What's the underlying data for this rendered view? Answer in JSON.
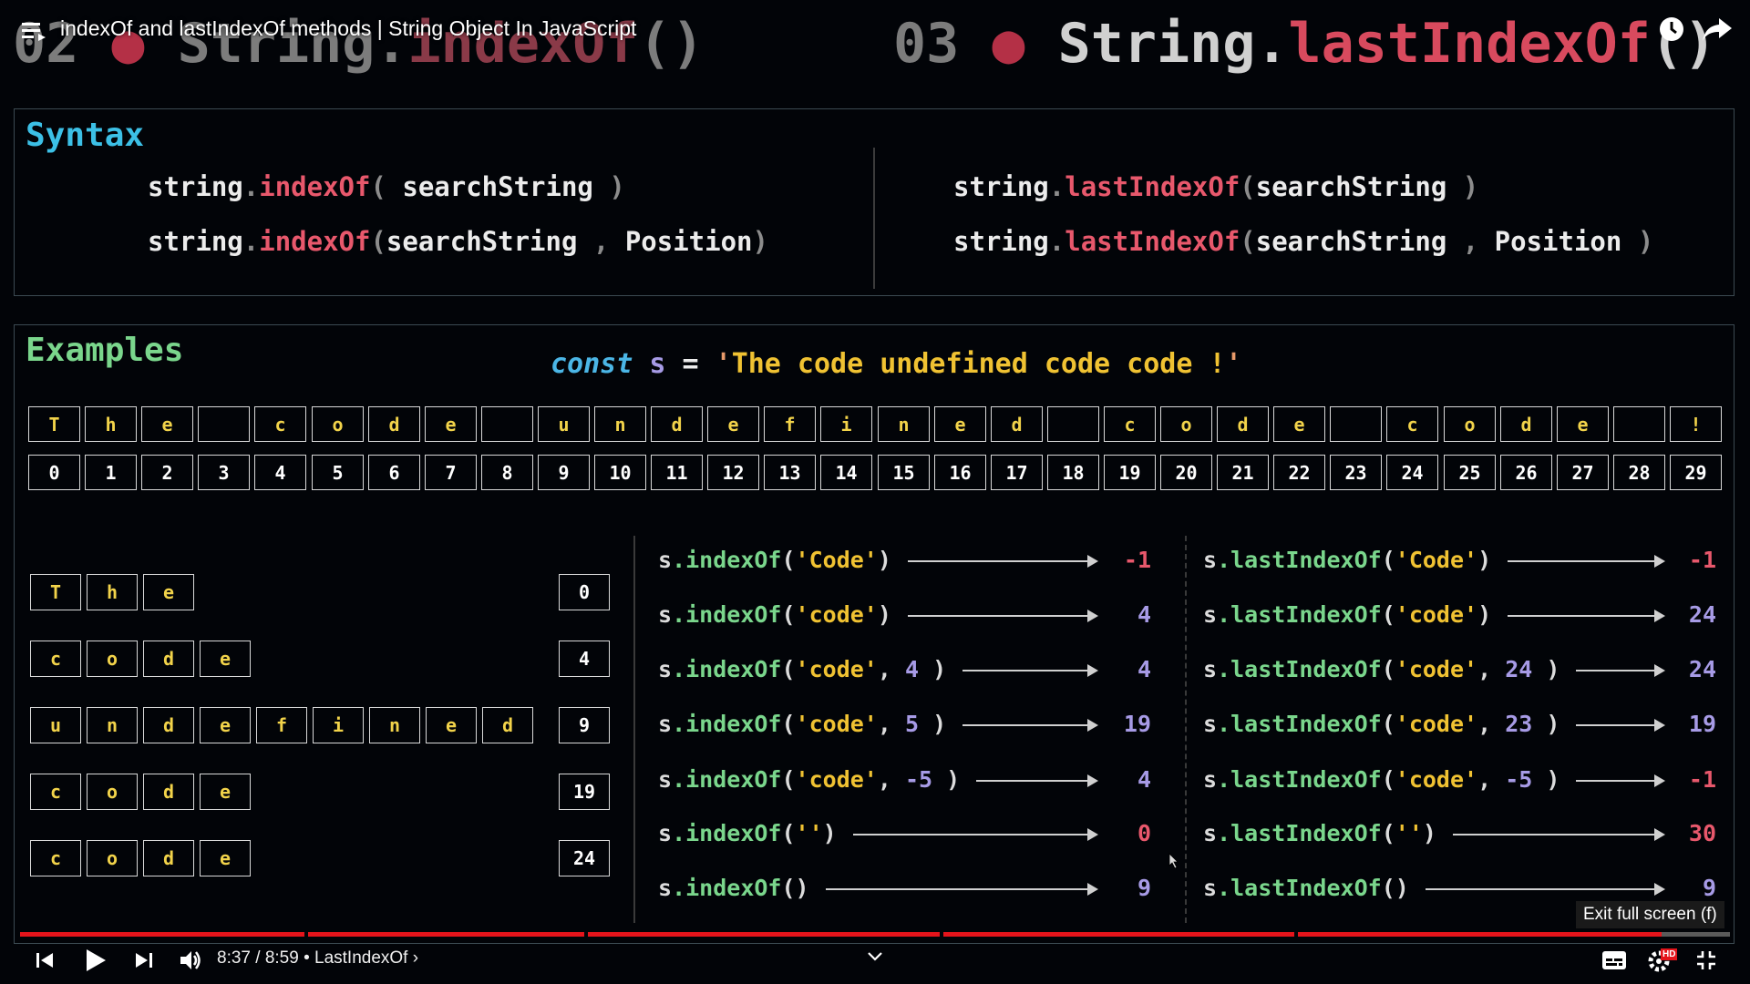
{
  "player": {
    "video_title": "indexOf and lastIndexOf methods | String Object In JavaScript",
    "time": "8:37 / 8:59",
    "chapter": "LastIndexOf",
    "chapter_suffix": "›",
    "exit_tooltip": "Exit full screen (f)",
    "progress_fraction": 0.96,
    "hd_badge": "HD",
    "icons": [
      "menu-icon",
      "clock-icon",
      "share-icon",
      "previous-icon",
      "play-icon",
      "next-icon",
      "volume-icon",
      "chevron-down-icon",
      "subtitles-icon",
      "settings-icon",
      "exit-fullscreen-icon"
    ]
  },
  "background": {
    "left_num": "02",
    "left_obj": "String.",
    "left_method": "indexOf",
    "left_parens": "()",
    "right_num": "03",
    "right_obj": "String.",
    "right_method": "lastIndexOf",
    "right_parens": "()",
    "dot": "●"
  },
  "syntax": {
    "title": "Syntax",
    "lines": [
      {
        "obj": "string",
        "dot": ".",
        "method": "indexOf",
        "open": "(",
        "args": " searchString ",
        "comma": "",
        "pos": "",
        "close": ")"
      },
      {
        "obj": "string",
        "dot": ".",
        "method": "indexOf",
        "open": "(",
        "args": "searchString ",
        "comma": ",",
        "pos": " Position",
        "close": ")"
      },
      {
        "obj": "string",
        "dot": ".",
        "method": "lastIndexOf",
        "open": "(",
        "args": "searchString ",
        "comma": "",
        "pos": "",
        "close": ")"
      },
      {
        "obj": "string",
        "dot": ".",
        "method": "lastIndexOf",
        "open": "(",
        "args": "searchString ",
        "comma": ",",
        "pos": " Position ",
        "close": ")"
      }
    ]
  },
  "examples": {
    "title": "Examples",
    "decl": {
      "kw": "const",
      "var": "s",
      "op": "=",
      "q1": "'",
      "value": "The code undefined code code !",
      "q2": "'"
    },
    "chars": [
      "T",
      "h",
      "e",
      "",
      "c",
      "o",
      "d",
      "e",
      "",
      "u",
      "n",
      "d",
      "e",
      "f",
      "i",
      "n",
      "e",
      "d",
      "",
      "c",
      "o",
      "d",
      "e",
      "",
      "c",
      "o",
      "d",
      "e",
      "",
      "!"
    ],
    "indices": [
      "0",
      "1",
      "2",
      "3",
      "4",
      "5",
      "6",
      "7",
      "8",
      "9",
      "10",
      "11",
      "12",
      "13",
      "14",
      "15",
      "16",
      "17",
      "18",
      "19",
      "20",
      "21",
      "22",
      "23",
      "24",
      "25",
      "26",
      "27",
      "28",
      "29"
    ],
    "words": [
      {
        "letters": [
          "T",
          "h",
          "e"
        ],
        "index": "0"
      },
      {
        "letters": [
          "c",
          "o",
          "d",
          "e"
        ],
        "index": "4"
      },
      {
        "letters": [
          "u",
          "n",
          "d",
          "e",
          "f",
          "i",
          "n",
          "e",
          "d"
        ],
        "index": "9"
      },
      {
        "letters": [
          "c",
          "o",
          "d",
          "e"
        ],
        "index": "19"
      },
      {
        "letters": [
          "c",
          "o",
          "d",
          "e"
        ],
        "index": "24"
      }
    ],
    "indexOf_calls": [
      {
        "obj": "s",
        "dot": ".",
        "method": "indexOf",
        "open": "(",
        "arg": "'Code'",
        "comma": "",
        "num": "",
        "close": ")",
        "result": "-1"
      },
      {
        "obj": "s",
        "dot": ".",
        "method": "indexOf",
        "open": "(",
        "arg": "'code'",
        "comma": "",
        "num": "",
        "close": ")",
        "result": "4"
      },
      {
        "obj": "s",
        "dot": ".",
        "method": "indexOf",
        "open": "(",
        "arg": "'code'",
        "comma": ",",
        "num": " 4",
        "close": " )",
        "result": "4"
      },
      {
        "obj": "s",
        "dot": ".",
        "method": "indexOf",
        "open": "(",
        "arg": "'code'",
        "comma": ",",
        "num": " 5",
        "close": " )",
        "result": "19"
      },
      {
        "obj": "s",
        "dot": ".",
        "method": "indexOf",
        "open": "(",
        "arg": "'code'",
        "comma": ",",
        "num": " -5",
        "close": " )",
        "result": "4"
      },
      {
        "obj": "s",
        "dot": ".",
        "method": "indexOf",
        "open": "(",
        "arg": "''",
        "comma": "",
        "num": "",
        "close": ")",
        "result": "0"
      },
      {
        "obj": "s",
        "dot": ".",
        "method": "indexOf",
        "open": "(",
        "arg": "",
        "comma": "",
        "num": "",
        "close": ")",
        "result": "9"
      }
    ],
    "lastIndexOf_calls": [
      {
        "obj": "s",
        "dot": ".",
        "method": "lastIndexOf",
        "open": "(",
        "arg": "'Code'",
        "comma": "",
        "num": "",
        "close": ")",
        "result": "-1"
      },
      {
        "obj": "s",
        "dot": ".",
        "method": "lastIndexOf",
        "open": "(",
        "arg": "'code'",
        "comma": "",
        "num": "",
        "close": ")",
        "result": "24"
      },
      {
        "obj": "s",
        "dot": ".",
        "method": "lastIndexOf",
        "open": "(",
        "arg": "'code'",
        "comma": ",",
        "num": " 24",
        "close": " )",
        "result": "24"
      },
      {
        "obj": "s",
        "dot": ".",
        "method": "lastIndexOf",
        "open": "(",
        "arg": "'code'",
        "comma": ",",
        "num": " 23",
        "close": " )",
        "result": "19"
      },
      {
        "obj": "s",
        "dot": ".",
        "method": "lastIndexOf",
        "open": "(",
        "arg": "'code'",
        "comma": ",",
        "num": " -5",
        "close": " )",
        "result": "-1"
      },
      {
        "obj": "s",
        "dot": ".",
        "method": "lastIndexOf",
        "open": "(",
        "arg": "''",
        "comma": "",
        "num": "",
        "close": ")",
        "result": "30"
      },
      {
        "obj": "s",
        "dot": ".",
        "method": "lastIndexOf",
        "open": "(",
        "arg": "",
        "comma": "",
        "num": "",
        "close": ")",
        "result": "9"
      }
    ]
  },
  "colors": {
    "accent_red": "#e8586c",
    "accent_green": "#7ad68c",
    "accent_blue": "#3cc0e6",
    "accent_yellow": "#f0c232",
    "accent_purple": "#a79be6",
    "progress_red": "#e5141b"
  }
}
